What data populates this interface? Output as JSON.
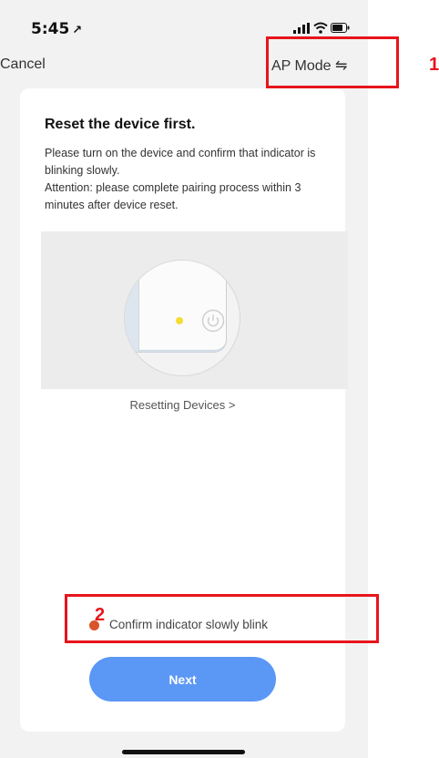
{
  "status_bar": {
    "time": "5:45",
    "location_arrow": "↗"
  },
  "nav": {
    "cancel_label": "Cancel",
    "ap_mode_label": "AP Mode",
    "switch_glyph": "⇋"
  },
  "card": {
    "title": "Reset the device first.",
    "instruction": "Please turn on the device and confirm that indicator is blinking slowly.",
    "attention": "Attention: please complete pairing process within 3 minutes after device reset.",
    "resetting_link": "Resetting Devices >",
    "confirm_label": "Confirm indicator slowly blink",
    "next_label": "Next"
  },
  "annotations": {
    "box1_number": "1",
    "box2_number": "2"
  },
  "icons": [
    "location-arrow-icon",
    "signal-icon",
    "wifi-icon",
    "battery-icon",
    "switch-icon",
    "power-icon"
  ],
  "colors": {
    "accent": "#5b97f5",
    "annotation": "#e8141b",
    "indicator": "#f5dc33",
    "radio": "#d9542b"
  }
}
